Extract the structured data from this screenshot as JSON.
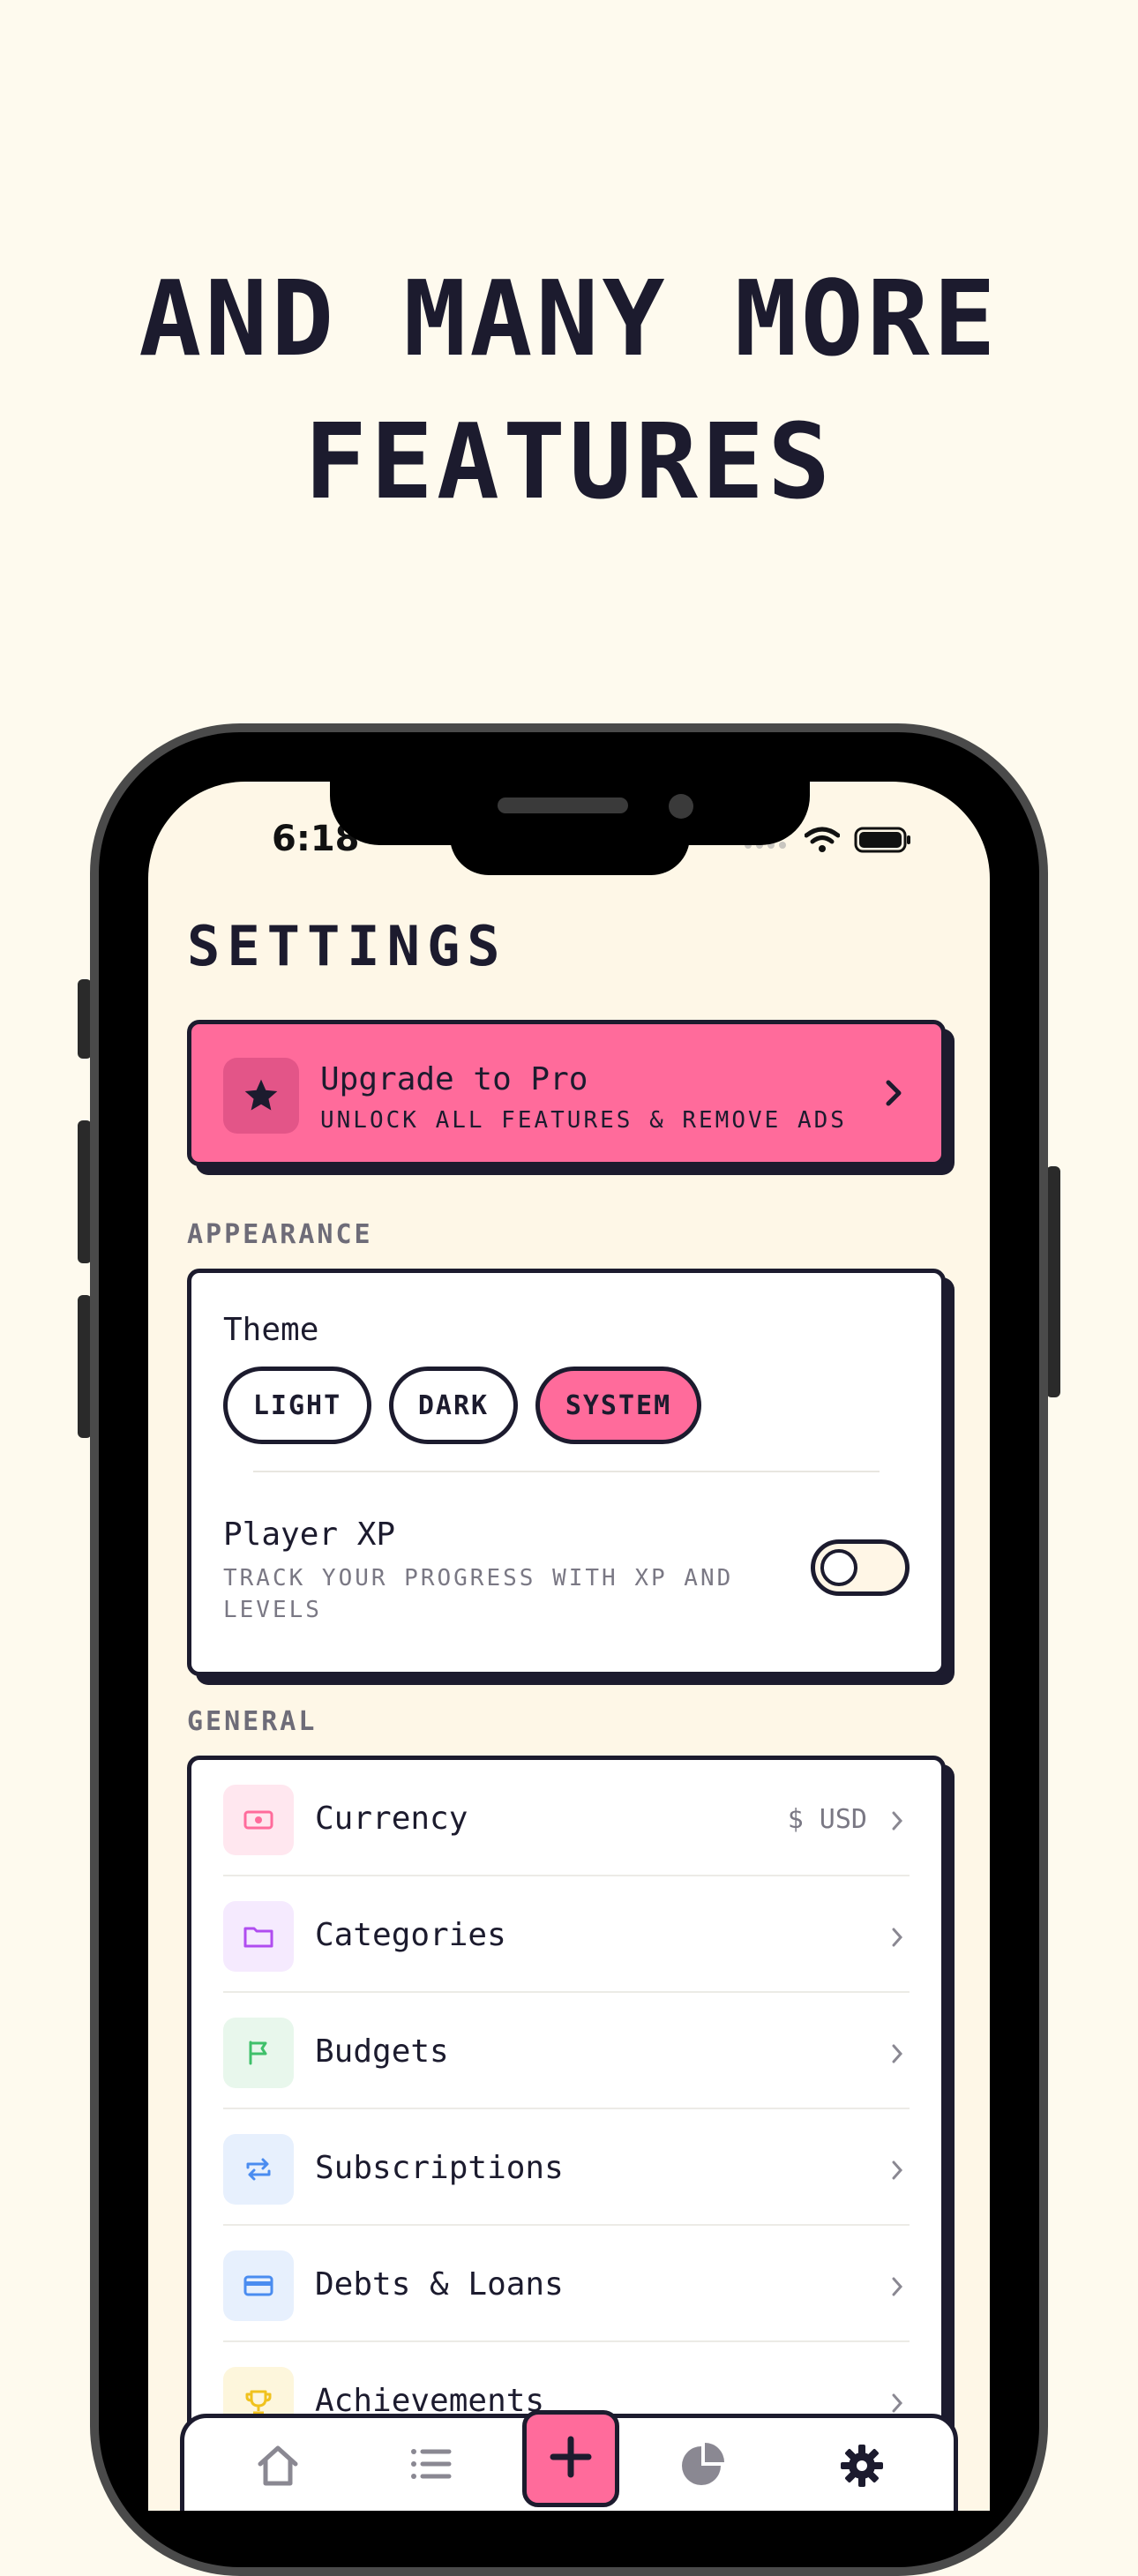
{
  "headline": {
    "line1": "AND MANY MORE",
    "line2": "FEATURES"
  },
  "status_bar": {
    "time": "6:18"
  },
  "page_title": "SETTINGS",
  "pro": {
    "title": "Upgrade to Pro",
    "subtitle": "UNLOCK ALL FEATURES & REMOVE ADS"
  },
  "appearance": {
    "section_label": "APPEARANCE",
    "theme_label": "Theme",
    "theme_options": [
      "LIGHT",
      "DARK",
      "SYSTEM"
    ],
    "selected_theme": "SYSTEM",
    "xp_title": "Player XP",
    "xp_subtitle": "TRACK YOUR PROGRESS WITH XP AND LEVELS",
    "xp_enabled": false
  },
  "general": {
    "section_label": "GENERAL",
    "items": [
      {
        "label": "Currency",
        "value": "$ USD",
        "icon": "banknote-icon",
        "color": "#ff6b9b",
        "bg": "#ffe7ef"
      },
      {
        "label": "Categories",
        "value": "",
        "icon": "folder-icon",
        "color": "#b04cf0",
        "bg": "#f5eafe"
      },
      {
        "label": "Budgets",
        "value": "",
        "icon": "flag-icon",
        "color": "#3fc06a",
        "bg": "#e8f7ec"
      },
      {
        "label": "Subscriptions",
        "value": "",
        "icon": "repeat-icon",
        "color": "#4a8cf0",
        "bg": "#e7f0fd"
      },
      {
        "label": "Debts & Loans",
        "value": "",
        "icon": "credit-card-icon",
        "color": "#4a8cf0",
        "bg": "#e7f0fd"
      },
      {
        "label": "Achievements",
        "value": "",
        "icon": "trophy-icon",
        "color": "#f0c21e",
        "bg": "#fdf6dc"
      }
    ]
  },
  "tab_bar": {
    "icons": [
      "home-icon",
      "list-icon",
      "plus-icon",
      "pie-chart-icon",
      "gear-icon"
    ]
  },
  "colors": {
    "accent": "#ff6b9b",
    "ink": "#1c1b2e",
    "background": "#fef7e7"
  }
}
